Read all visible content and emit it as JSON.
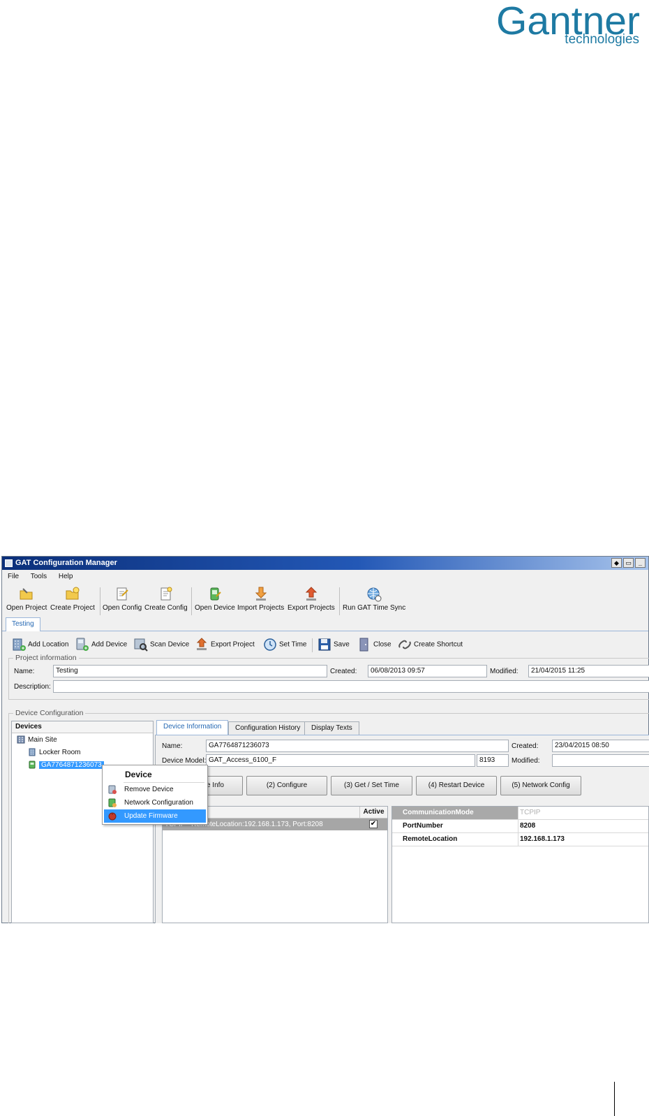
{
  "logo": {
    "main": "Gantner",
    "sub": "technologies"
  },
  "window": {
    "title": "GAT Configuration Manager",
    "title_buttons": [
      "◆",
      "▭",
      "_"
    ]
  },
  "menubar": {
    "items": [
      "File",
      "Tools",
      "Help"
    ]
  },
  "main_toolbar": {
    "items": [
      {
        "label": "Open Project",
        "icon": "folder-open-icon"
      },
      {
        "label": "Create Project",
        "icon": "folder-new-icon"
      },
      {
        "label": "Open Config",
        "icon": "config-open-icon"
      },
      {
        "label": "Create Config",
        "icon": "config-new-icon"
      },
      {
        "label": "Open Device",
        "icon": "device-open-icon"
      },
      {
        "label": "Import Projects",
        "icon": "import-icon"
      },
      {
        "label": "Export Projects",
        "icon": "export-icon"
      },
      {
        "label": "Run GAT Time Sync",
        "icon": "globe-clock-icon"
      }
    ]
  },
  "project_tab": "Testing",
  "secondary_toolbar": {
    "items": [
      {
        "label": "Add Location",
        "icon": "building-add-icon"
      },
      {
        "label": "Add Device",
        "icon": "device-add-icon"
      },
      {
        "label": "Scan Device",
        "icon": "scan-icon"
      },
      {
        "label": "Export Project",
        "icon": "export-icon"
      },
      {
        "label": "Set Time",
        "icon": "clock-icon"
      },
      {
        "label": "Save",
        "icon": "floppy-icon"
      },
      {
        "label": "Close",
        "icon": "door-icon"
      },
      {
        "label": "Create Shortcut",
        "icon": "link-icon"
      }
    ]
  },
  "project_info": {
    "title": "Project information",
    "name_label": "Name:",
    "name_value": "Testing",
    "created_label": "Created:",
    "created_value": "06/08/2013 09:57",
    "modified_label": "Modified:",
    "modified_value": "21/04/2015 11:25",
    "description_label": "Description:",
    "description_value": ""
  },
  "device_config": {
    "title": "Device Configuration",
    "devices_header": "Devices",
    "tree": [
      {
        "label": "Main Site",
        "icon": "site-icon"
      },
      {
        "label": "Locker Room",
        "icon": "building-icon"
      },
      {
        "label": "GA7764871236073",
        "icon": "device-icon"
      }
    ]
  },
  "context_menu": {
    "title": "Device",
    "items": [
      {
        "label": "Remove Device",
        "icon": "remove-device-icon"
      },
      {
        "label": "Network Configuration",
        "icon": "network-config-icon"
      },
      {
        "label": "Update Firmware",
        "icon": "firmware-icon"
      }
    ]
  },
  "device_tabs": [
    "Device Information",
    "Configuration History",
    "Display Texts"
  ],
  "device_info": {
    "name_label": "Name:",
    "name_value": "GA7764871236073",
    "created_label": "Created:",
    "created_value": "23/04/2015 08:50",
    "model_label": "Device Model:",
    "model_value": "GAT_Access_6100_F",
    "model_code": "8193",
    "modified_label": "Modified:",
    "modified_value": ""
  },
  "actions": [
    "e Info",
    "(2) Configure",
    "(3) Get / Set Time",
    "(4) Restart Device",
    "(5) Network Config"
  ],
  "comm_grid": {
    "active_header": "Active",
    "row_text": "TCPIP - RemoteLocation:192.168.1.173, Port:8208",
    "row_active": "✔"
  },
  "properties": [
    {
      "key": "CommunicationMode",
      "value": "TCPIP"
    },
    {
      "key": "PortNumber",
      "value": "8208"
    },
    {
      "key": "RemoteLocation",
      "value": "192.168.1.173"
    }
  ]
}
